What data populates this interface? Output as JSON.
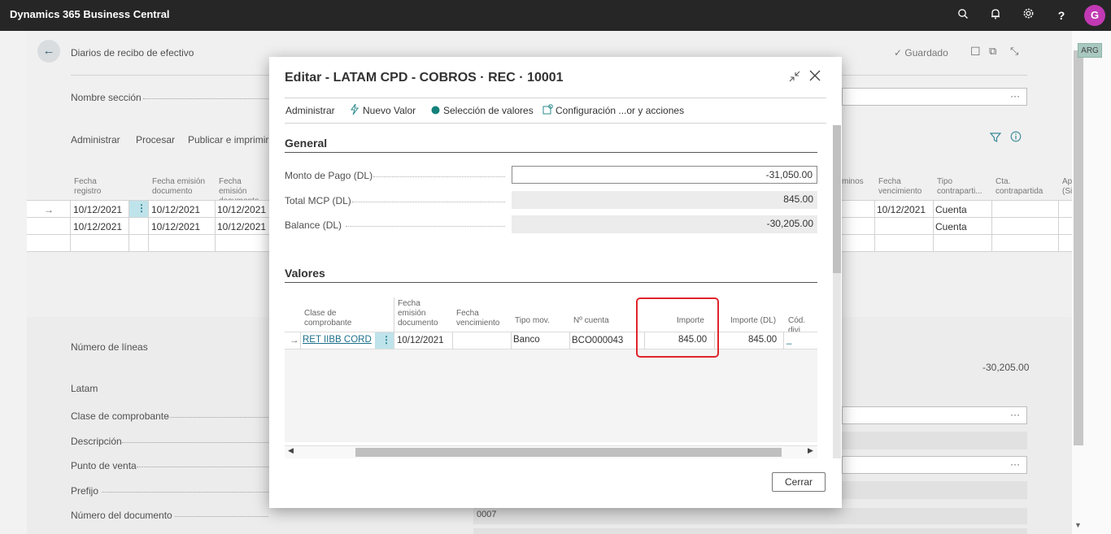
{
  "app": {
    "title": "Dynamics 365 Business Central",
    "avatar_letter": "G"
  },
  "topbar_icons": [
    "search-icon",
    "bell-icon",
    "gear-icon",
    "help-icon"
  ],
  "page": {
    "breadcrumb": "Diarios de recibo de efectivo",
    "saved_status": "✓ Guardado",
    "badge": "ARG",
    "section_name_label": "Nombre sección",
    "menu": [
      "Administrar",
      "Procesar",
      "Publicar e imprimir"
    ],
    "grid_headers": {
      "fecha_registro": "Fecha registro",
      "fecha_emision_1": "Fecha emisión documento",
      "fecha_emision_2": "Fecha emisión documento",
      "terminos": "minos",
      "fecha_vencimiento": "Fecha vencimiento",
      "tipo_contrapartida": "Tipo contraparti...",
      "cta_contrapartida": "Cta. contrapartida",
      "ap": "Ap (Si"
    },
    "grid_rows": [
      {
        "fecha_registro": "10/12/2021",
        "fecha_emision_1": "10/12/2021",
        "fecha_emision_2": "10/12/2021",
        "fecha_vencimiento": "10/12/2021",
        "tipo": "Cuenta"
      },
      {
        "fecha_registro": "10/12/2021",
        "fecha_emision_1": "10/12/2021",
        "fecha_emision_2": "10/12/2021",
        "fecha_vencimiento": "",
        "tipo": "Cuenta"
      }
    ],
    "lines_label": "Número de líneas",
    "balance_value": "-30,205.00",
    "latam_label": "Latam",
    "latam_fields": [
      "Clase de comprobante",
      "Descripción",
      "Punto de venta",
      "Prefijo",
      "Número del documento"
    ],
    "numero_documento_value": "0007"
  },
  "modal": {
    "title": "Editar - LATAM CPD - COBROS · REC · 10001",
    "actions": [
      "Administrar",
      "Nuevo Valor",
      "Selección de valores",
      "Configuración ...or y acciones"
    ],
    "general_title": "General",
    "fields": [
      {
        "label": "Monto de Pago (DL)",
        "value": "-31,050.00"
      },
      {
        "label": "Total MCP (DL)",
        "value": "845.00"
      },
      {
        "label": "Balance (DL)",
        "value": "-30,205.00"
      }
    ],
    "valores_title": "Valores",
    "valores_headers": {
      "clase": "Clase de comprobante",
      "fecha_emision": "Fecha emisión documento",
      "fecha_venc": "Fecha vencimiento",
      "tipo_mov": "Tipo mov.",
      "n_cuenta": "Nº cuenta",
      "importe": "Importe",
      "importe_dl": "Importe (DL)",
      "cod_div": "Cód. divi"
    },
    "valores_row": {
      "clase": "RET IIBB CORD",
      "fecha_emision": "10/12/2021",
      "fecha_venc": "",
      "tipo_mov": "Banco",
      "n_cuenta": "BCO000043",
      "importe": "845.00",
      "importe_dl": "845.00",
      "cod_div": "_"
    },
    "close_button": "Cerrar"
  }
}
